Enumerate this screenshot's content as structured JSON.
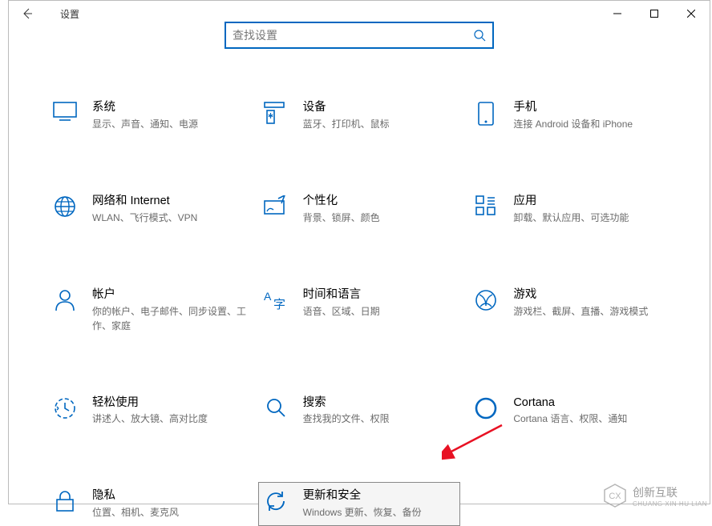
{
  "window": {
    "title": "设置"
  },
  "search": {
    "placeholder": "查找设置"
  },
  "tiles": [
    {
      "id": "system",
      "title": "系统",
      "desc": "显示、声音、通知、电源"
    },
    {
      "id": "devices",
      "title": "设备",
      "desc": "蓝牙、打印机、鼠标"
    },
    {
      "id": "phone",
      "title": "手机",
      "desc": "连接 Android 设备和 iPhone"
    },
    {
      "id": "network",
      "title": "网络和 Internet",
      "desc": "WLAN、飞行模式、VPN"
    },
    {
      "id": "personal",
      "title": "个性化",
      "desc": "背景、锁屏、颜色"
    },
    {
      "id": "apps",
      "title": "应用",
      "desc": "卸载、默认应用、可选功能"
    },
    {
      "id": "accounts",
      "title": "帐户",
      "desc": "你的帐户、电子邮件、同步设置、工作、家庭"
    },
    {
      "id": "timelang",
      "title": "时间和语言",
      "desc": "语音、区域、日期"
    },
    {
      "id": "gaming",
      "title": "游戏",
      "desc": "游戏栏、截屏、直播、游戏模式"
    },
    {
      "id": "ease",
      "title": "轻松使用",
      "desc": "讲述人、放大镜、高对比度"
    },
    {
      "id": "searchc",
      "title": "搜索",
      "desc": "查找我的文件、权限"
    },
    {
      "id": "cortana",
      "title": "Cortana",
      "desc": "Cortana 语言、权限、通知"
    },
    {
      "id": "privacy",
      "title": "隐私",
      "desc": "位置、相机、麦克风"
    },
    {
      "id": "update",
      "title": "更新和安全",
      "desc": "Windows 更新、恢复、备份",
      "highlighted": true
    }
  ],
  "watermark": {
    "brand": "创新互联",
    "sub": "CHUANG XIN HU LIAN"
  },
  "colors": {
    "accent": "#0067c0",
    "icon": "#0067c0"
  }
}
